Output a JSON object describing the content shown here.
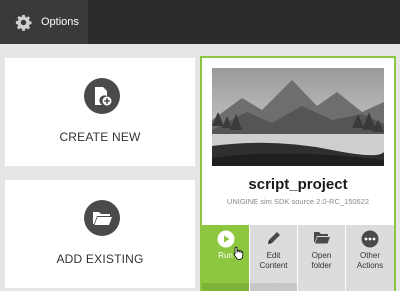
{
  "topbar": {
    "options_label": "Options",
    "options_icon": "gear-icon"
  },
  "cards": {
    "create_label": "CREATE NEW",
    "create_icon": "new-document-icon",
    "add_label": "ADD EXISTING",
    "add_icon": "folder-icon"
  },
  "project": {
    "title": "script_project",
    "subtitle": "UNIGINE sim SDK source 2.0-RC_150622",
    "thumbnail_icon": "mountain-landscape-image",
    "accent_color": "#8dc63f",
    "actions": [
      {
        "label": "Run",
        "icon": "play-icon"
      },
      {
        "label": "Edit Content",
        "icon": "pencil-icon"
      },
      {
        "label": "Open folder",
        "icon": "folder-icon"
      },
      {
        "label": "Other Actions",
        "icon": "more-icon"
      }
    ]
  }
}
